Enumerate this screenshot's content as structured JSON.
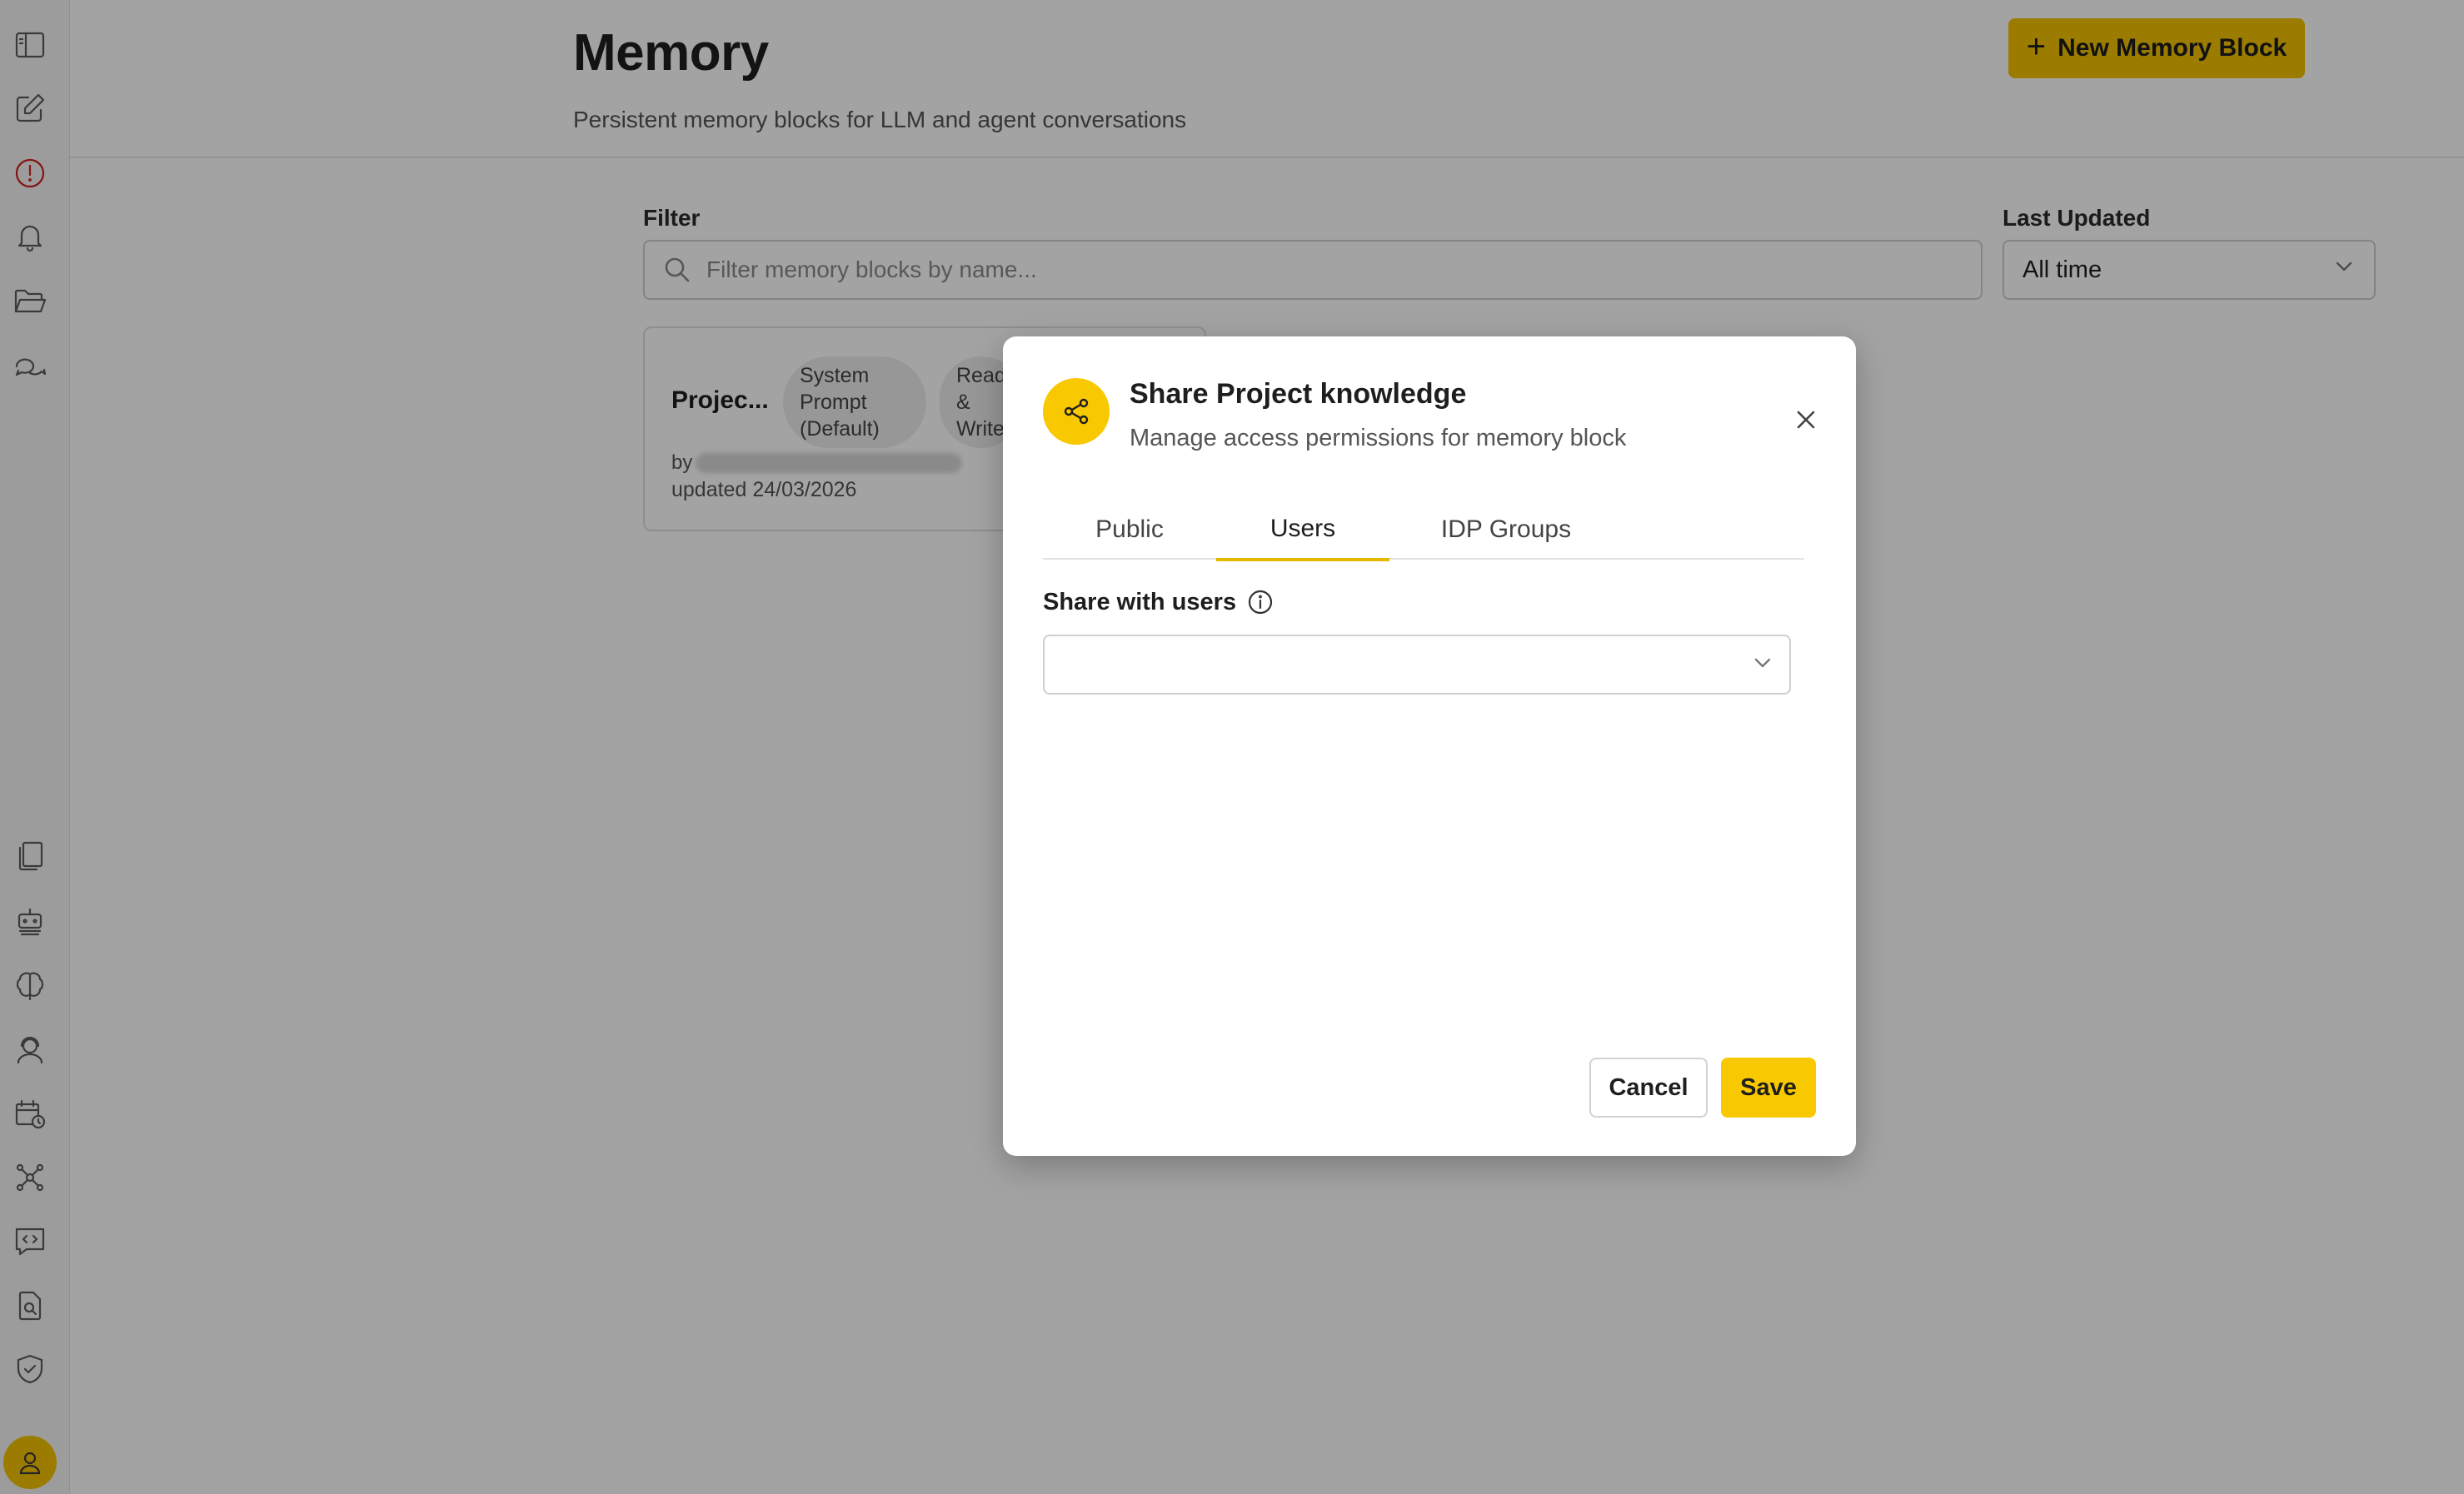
{
  "header": {
    "title": "Memory",
    "subtitle": "Persistent memory blocks for LLM and agent conversations",
    "new_button_label": "New Memory Block"
  },
  "filters": {
    "filter_label": "Filter",
    "filter_placeholder": "Filter memory blocks by name...",
    "last_updated_label": "Last Updated",
    "last_updated_value": "All time"
  },
  "card": {
    "name": "Projec...",
    "badge_1": [
      "System",
      "Prompt",
      "(Default)"
    ],
    "badge_2": [
      "Read",
      "&",
      "Write"
    ],
    "by_label": "by",
    "updated": "updated 24/03/2026"
  },
  "dialog": {
    "title": "Share Project knowledge",
    "subtitle": "Manage access permissions for memory block",
    "tabs": [
      "Public",
      "Users",
      "IDP Groups"
    ],
    "active_tab": "Users",
    "share_label": "Share with users",
    "cancel_label": "Cancel",
    "save_label": "Save"
  },
  "colors": {
    "accent": "#f8c800",
    "alert": "#d21f1f",
    "overlay": "rgba(0,0,0,0.36)"
  },
  "sidebar_icons": [
    "sidebar-toggle-icon",
    "edit-icon",
    "alert-icon",
    "bell-icon",
    "folder-icon",
    "chat-icon",
    "documents-icon",
    "robot-icon",
    "brain-icon",
    "agent-icon",
    "schedule-icon",
    "network-icon",
    "code-chat-icon",
    "file-search-icon",
    "shield-check-icon",
    "user-icon"
  ]
}
